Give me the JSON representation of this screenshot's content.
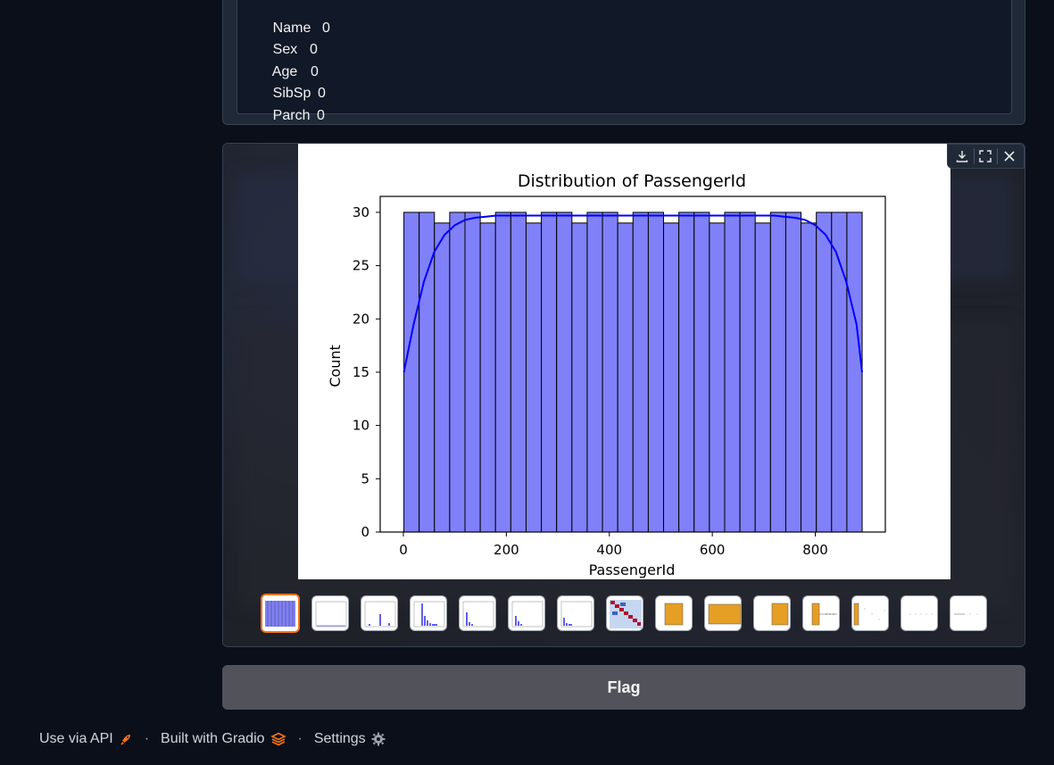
{
  "missing_values": [
    {
      "key": "Name",
      "value": "0"
    },
    {
      "key": "Sex",
      "value": "0"
    },
    {
      "key": "Age",
      "value": "0"
    },
    {
      "key": "SibSp",
      "value": "0"
    },
    {
      "key": "Parch",
      "value": "0"
    }
  ],
  "gallery": {
    "toolbar": [
      "download-icon",
      "fullscreen-icon",
      "close-icon"
    ],
    "thumbnail_count": 15,
    "selected_index": 0
  },
  "chart_data": {
    "type": "bar",
    "title": "Distribution of PassengerId",
    "xlabel": "PassengerId",
    "ylabel": "Count",
    "xlim": [
      -45,
      936
    ],
    "ylim": [
      0,
      31.5
    ],
    "xticks": [
      "0",
      "200",
      "400",
      "600",
      "800"
    ],
    "yticks": [
      "0",
      "5",
      "10",
      "15",
      "20",
      "25",
      "30"
    ],
    "bin_edges": [
      1,
      30.67,
      60.33,
      90,
      119.67,
      149.33,
      179,
      208.67,
      238.33,
      268,
      297.67,
      327.33,
      357,
      386.67,
      416.33,
      446,
      475.67,
      505.33,
      535,
      564.67,
      594.33,
      624,
      653.67,
      683.33,
      713,
      742.67,
      772.33,
      802,
      831.67,
      861.33,
      891
    ],
    "values": [
      30,
      30,
      29,
      30,
      30,
      29,
      30,
      30,
      29,
      30,
      30,
      29,
      30,
      30,
      29,
      30,
      30,
      29,
      30,
      30,
      29,
      30,
      30,
      29,
      30,
      30,
      29,
      30,
      30,
      30
    ],
    "bar_color": "#8080f8",
    "kde": {
      "x": [
        1,
        20,
        40,
        60,
        80,
        100,
        120,
        140,
        160,
        180,
        200,
        250,
        300,
        350,
        400,
        450,
        500,
        550,
        600,
        650,
        700,
        720,
        740,
        760,
        780,
        800,
        820,
        840,
        860,
        880,
        891
      ],
      "y": [
        15,
        19.5,
        23.5,
        26.3,
        27.9,
        28.8,
        29.3,
        29.5,
        29.6,
        29.7,
        29.7,
        29.7,
        29.7,
        29.7,
        29.7,
        29.7,
        29.7,
        29.7,
        29.7,
        29.7,
        29.7,
        29.7,
        29.6,
        29.5,
        29.3,
        28.8,
        27.9,
        26.3,
        23.5,
        19.5,
        15
      ],
      "color": "#0000ff"
    }
  },
  "flag_button": {
    "label": "Flag"
  },
  "footer": {
    "api_label": "Use via API",
    "built_label": "Built with Gradio",
    "settings_label": "Settings",
    "separator": "·"
  }
}
